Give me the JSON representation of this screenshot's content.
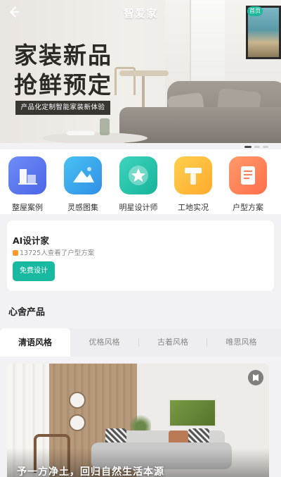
{
  "nav": {
    "title": "智爱家",
    "corner_badge": "首页"
  },
  "banner": {
    "headline_line1": "家装新品",
    "headline_line2": "抢鲜预定",
    "tagline": "产品化定制智能家装新体验",
    "slide_index": 1,
    "slide_count": 3
  },
  "quick_entries": [
    {
      "label": "整屋案例",
      "icon": "house-icon"
    },
    {
      "label": "灵感图集",
      "icon": "mountain-image-icon"
    },
    {
      "label": "明星设计师",
      "icon": "star-badge-icon"
    },
    {
      "label": "工地实况",
      "icon": "construction-icon"
    },
    {
      "label": "户型方案",
      "icon": "document-icon"
    }
  ],
  "ai_designer": {
    "title": "AI设计家",
    "subtitle": "13725人查看了户型方案",
    "button_label": "免费设计"
  },
  "products": {
    "section_title": "心舍产品",
    "tabs": [
      {
        "label": "清语风格",
        "active": true
      },
      {
        "label": "优格风格",
        "active": false
      },
      {
        "label": "古着风格",
        "active": false
      },
      {
        "label": "唯思风格",
        "active": false
      }
    ],
    "card_caption": "予一方净土，回归自然生活本源"
  },
  "colors": {
    "accent": "#19b8a0",
    "background": "#f2f2f4"
  }
}
